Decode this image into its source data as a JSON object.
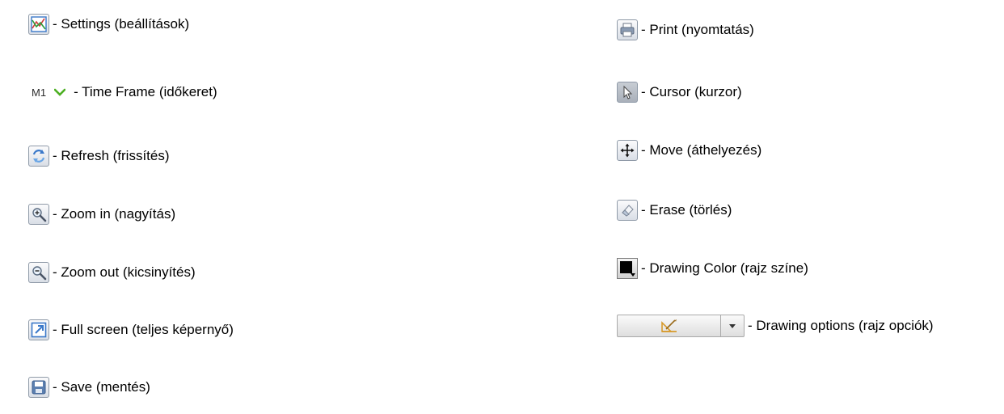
{
  "legend": {
    "settings": {
      "icon": "settings-chart-icon",
      "label": "- Settings (beállítások)"
    },
    "timeframe": {
      "value": "M1",
      "icon": "chevron-down-icon",
      "label": "- Time Frame (időkeret)"
    },
    "refresh": {
      "icon": "refresh-icon",
      "label": "- Refresh (frissítés)"
    },
    "zoom_in": {
      "icon": "zoom-in-icon",
      "label": "- Zoom in (nagyítás)"
    },
    "zoom_out": {
      "icon": "zoom-out-icon",
      "label": "- Zoom out (kicsinyítés)"
    },
    "full_screen": {
      "icon": "full-screen-icon",
      "label": "- Full screen (teljes képernyő)"
    },
    "save": {
      "icon": "save-icon",
      "label": "- Save (mentés)"
    },
    "print": {
      "icon": "print-icon",
      "label": "- Print (nyomtatás)"
    },
    "cursor": {
      "icon": "cursor-icon",
      "label": "- Cursor (kurzor)"
    },
    "move": {
      "icon": "move-icon",
      "label": "- Move (áthelyezés)"
    },
    "erase": {
      "icon": "eraser-icon",
      "label": "- Erase (törlés)"
    },
    "drawing_color": {
      "icon": "color-swatch-icon",
      "swatch": "#000000",
      "label": "- Drawing Color (rajz színe)"
    },
    "drawing_options": {
      "icon": "drawing-tools-icon",
      "label": "- Drawing options (rajz opciók)"
    }
  },
  "colors": {
    "icon_blue": "#3a78c9",
    "timeframe_chevron": "#4caf22",
    "drawing_tool": "#d79a2b"
  }
}
